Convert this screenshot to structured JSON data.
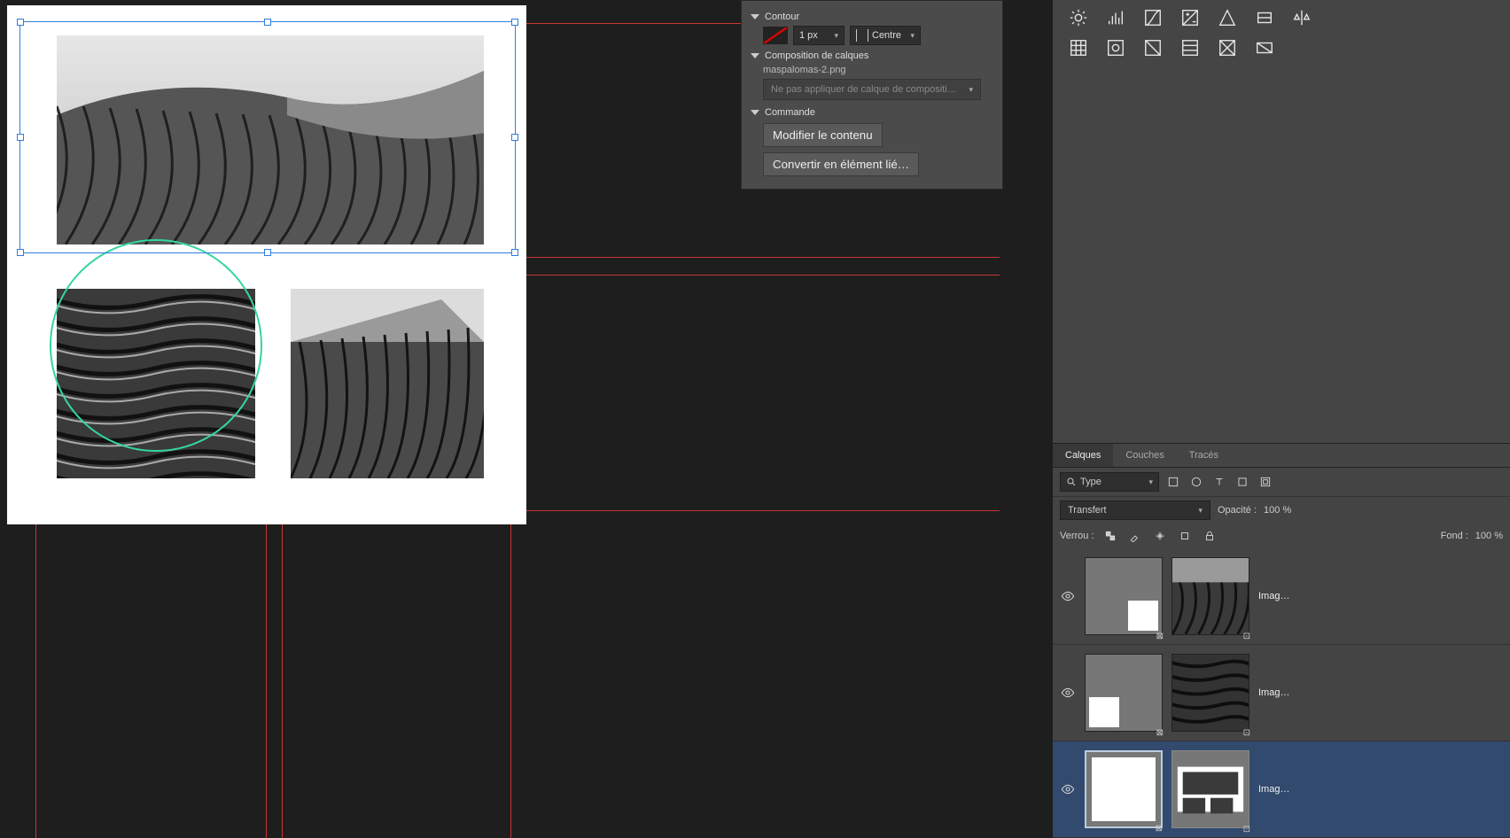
{
  "panel": {
    "contour": {
      "label": "Contour",
      "stroke_width": "1 px",
      "align": "Centre"
    },
    "layercomp": {
      "label": "Composition de calques",
      "filename": "maspalomas-2.png",
      "dropdown_placeholder": "Ne pas appliquer de calque de compositi…"
    },
    "command": {
      "label": "Commande",
      "edit_btn": "Modifier le contenu",
      "convert_btn": "Convertir en élément lié…"
    }
  },
  "layers": {
    "tabs": {
      "layers": "Calques",
      "channels": "Couches",
      "paths": "Tracés"
    },
    "filter_label": "Type",
    "blend_mode": "Transfert",
    "opacity_label": "Opacité :",
    "opacity_value": "100 %",
    "lock_label": "Verrou :",
    "fill_label": "Fond :",
    "fill_value": "100 %",
    "items": [
      {
        "name": "Imag…"
      },
      {
        "name": "Imag…"
      },
      {
        "name": "Imag…"
      }
    ]
  }
}
